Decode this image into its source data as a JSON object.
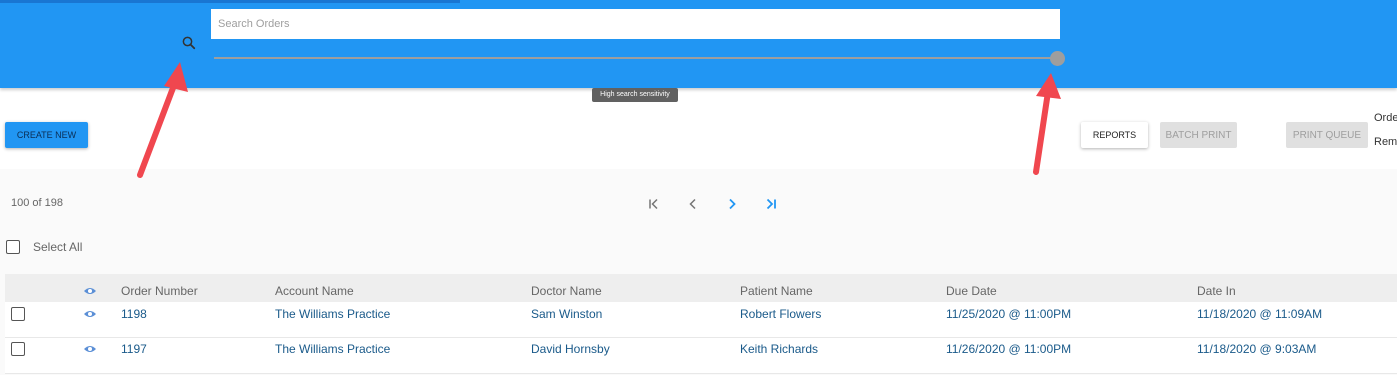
{
  "header": {
    "search": {
      "placeholder": "Search Orders",
      "value": ""
    },
    "sensitivity_tooltip": "High search sensitivity",
    "sensitivity_level": 1.0
  },
  "toolbar": {
    "create_new": "CREATE NEW",
    "reports": "REPORTS",
    "batch_print": "BATCH PRINT",
    "print_queue": "PRINT QUEUE",
    "side_text_1": "Orde",
    "side_text_2": "Rem"
  },
  "pagination": {
    "count": "100 of 198"
  },
  "select_all": "Select All",
  "table": {
    "columns": [
      "Order Number",
      "Account Name",
      "Doctor Name",
      "Patient Name",
      "Due Date",
      "Date In"
    ],
    "rows": [
      {
        "order": "1198",
        "account": "The Williams Practice",
        "doctor": "Sam Winston",
        "patient": "Robert Flowers",
        "due": "11/25/2020 @ 11:00PM",
        "date_in": "11/18/2020 @ 11:09AM"
      },
      {
        "order": "1197",
        "account": "The Williams Practice",
        "doctor": "David Hornsby",
        "patient": "Keith Richards",
        "due": "11/26/2020 @ 11:00PM",
        "date_in": "11/18/2020 @ 9:03AM"
      }
    ]
  },
  "colors": {
    "header": "#2196f3",
    "link": "#1a5a8a",
    "annotation_arrow": "#f0474f",
    "pager_active": "#2196f3",
    "pager_inactive": "#757575"
  }
}
